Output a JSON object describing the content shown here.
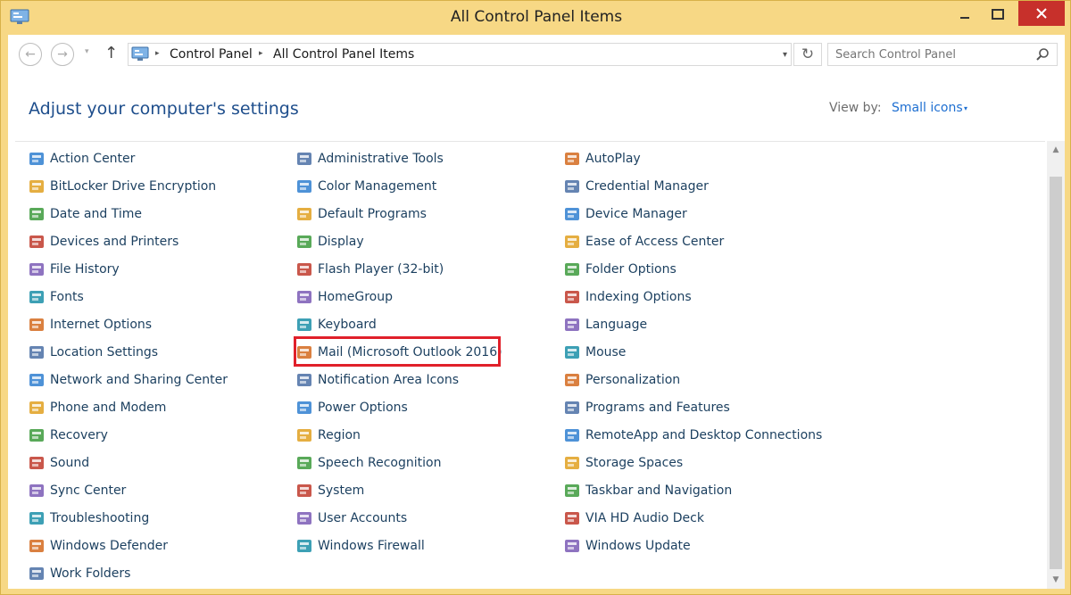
{
  "window": {
    "title": "All Control Panel Items"
  },
  "nav": {
    "back_glyph": "←",
    "forward_glyph": "→",
    "dropdown_glyph": "▾",
    "up_glyph": "↑",
    "refresh_glyph": "↻"
  },
  "breadcrumb": {
    "items": [
      "Control Panel",
      "All Control Panel Items"
    ],
    "separator": "▸"
  },
  "search": {
    "placeholder": "Search Control Panel"
  },
  "header": {
    "title": "Adjust your computer's settings",
    "view_by_label": "View by:",
    "view_by_value": "Small icons",
    "view_by_arrow": "▾"
  },
  "items": {
    "col1": [
      {
        "label": "Action Center",
        "icon": "flag-icon"
      },
      {
        "label": "BitLocker Drive Encryption",
        "icon": "key-icon"
      },
      {
        "label": "Date and Time",
        "icon": "calendar-icon"
      },
      {
        "label": "Devices and Printers",
        "icon": "printer-icon"
      },
      {
        "label": "File History",
        "icon": "file-history-icon"
      },
      {
        "label": "Fonts",
        "icon": "fonts-icon"
      },
      {
        "label": "Internet Options",
        "icon": "globe-icon"
      },
      {
        "label": "Location Settings",
        "icon": "location-icon"
      },
      {
        "label": "Network and Sharing Center",
        "icon": "network-icon"
      },
      {
        "label": "Phone and Modem",
        "icon": "phone-icon"
      },
      {
        "label": "Recovery",
        "icon": "recovery-icon"
      },
      {
        "label": "Sound",
        "icon": "speaker-icon"
      },
      {
        "label": "Sync Center",
        "icon": "sync-icon"
      },
      {
        "label": "Troubleshooting",
        "icon": "troubleshoot-icon"
      },
      {
        "label": "Windows Defender",
        "icon": "shield-icon"
      },
      {
        "label": "Work Folders",
        "icon": "folder-icon"
      }
    ],
    "col2": [
      {
        "label": "Administrative Tools",
        "icon": "tools-icon"
      },
      {
        "label": "Color Management",
        "icon": "color-icon"
      },
      {
        "label": "Default Programs",
        "icon": "default-programs-icon"
      },
      {
        "label": "Display",
        "icon": "monitor-icon"
      },
      {
        "label": "Flash Player (32-bit)",
        "icon": "flash-icon"
      },
      {
        "label": "HomeGroup",
        "icon": "homegroup-icon"
      },
      {
        "label": "Keyboard",
        "icon": "keyboard-icon"
      },
      {
        "label": "Mail (Microsoft Outlook 2016)",
        "icon": "mail-icon"
      },
      {
        "label": "Notification Area Icons",
        "icon": "notification-icon"
      },
      {
        "label": "Power Options",
        "icon": "power-icon"
      },
      {
        "label": "Region",
        "icon": "region-icon"
      },
      {
        "label": "Speech Recognition",
        "icon": "microphone-icon"
      },
      {
        "label": "System",
        "icon": "system-icon"
      },
      {
        "label": "User Accounts",
        "icon": "users-icon"
      },
      {
        "label": "Windows Firewall",
        "icon": "firewall-icon"
      }
    ],
    "col3": [
      {
        "label": "AutoPlay",
        "icon": "autoplay-icon"
      },
      {
        "label": "Credential Manager",
        "icon": "credential-icon"
      },
      {
        "label": "Device Manager",
        "icon": "device-manager-icon"
      },
      {
        "label": "Ease of Access Center",
        "icon": "ease-of-access-icon"
      },
      {
        "label": "Folder Options",
        "icon": "folder-options-icon"
      },
      {
        "label": "Indexing Options",
        "icon": "indexing-icon"
      },
      {
        "label": "Language",
        "icon": "language-icon"
      },
      {
        "label": "Mouse",
        "icon": "mouse-icon"
      },
      {
        "label": "Personalization",
        "icon": "personalization-icon"
      },
      {
        "label": "Programs and Features",
        "icon": "programs-icon"
      },
      {
        "label": "RemoteApp and Desktop Connections",
        "icon": "remoteapp-icon"
      },
      {
        "label": "Storage Spaces",
        "icon": "storage-icon"
      },
      {
        "label": "Taskbar and Navigation",
        "icon": "taskbar-icon"
      },
      {
        "label": "VIA HD Audio Deck",
        "icon": "audio-deck-icon"
      },
      {
        "label": "Windows Update",
        "icon": "update-icon"
      }
    ]
  },
  "highlighted_item": "Mail (Microsoft Outlook 2016)",
  "colors": {
    "frame": "#f7d885",
    "link": "#1b3f5f",
    "heading": "#1e4e8c",
    "accent": "#1e6fd1",
    "close": "#c7302b",
    "highlight": "#e0202a"
  }
}
